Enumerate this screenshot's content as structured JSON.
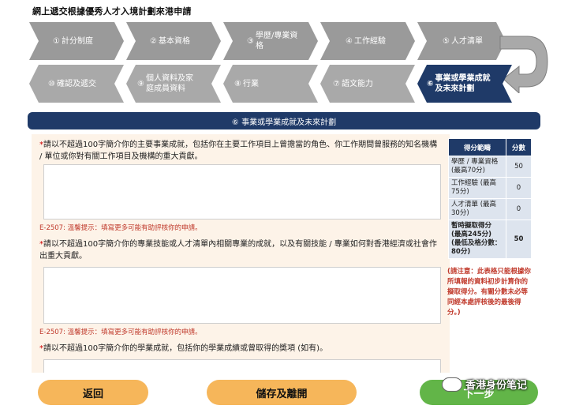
{
  "page_title": "網上遞交根據優秀人才入境計劃來港申請",
  "steps": [
    {
      "num": "①",
      "label": "計分制度",
      "state": "done"
    },
    {
      "num": "②",
      "label": "基本資格",
      "state": "done"
    },
    {
      "num": "③",
      "label": "學歷/專業資格",
      "state": "done"
    },
    {
      "num": "④",
      "label": "工作經驗",
      "state": "done"
    },
    {
      "num": "⑤",
      "label": "人才清單",
      "state": "done"
    },
    {
      "num": "⑩",
      "label": "確認及遞交",
      "state": "pending"
    },
    {
      "num": "⑨",
      "label": "個人資料及家庭成員資料",
      "state": "pending"
    },
    {
      "num": "⑧",
      "label": "行業",
      "state": "pending"
    },
    {
      "num": "⑦",
      "label": "語文能力",
      "state": "pending"
    },
    {
      "num": "⑥",
      "label": "事業或學業成就及未來計劃",
      "state": "active"
    }
  ],
  "section_title": "⑥ 事業或學業成就及未來計劃",
  "questions": [
    {
      "star": "*",
      "text": "請以不超過100字簡介你的主要事業成就，包括你在主要工作項目上曾擔當的角色、你工作期間曾服務的知名機構 / 單位或你對有關工作項目及機構的重大貢獻。",
      "value": "",
      "error": "E-2507: 溫馨提示：填寫更多可能有助評核你的申請。"
    },
    {
      "star": "*",
      "text": "請以不超過100字簡介你的專業技能或人才清單內相關專業的成就，以及有關技能 / 專業如何對香港經濟或社會作出重大貢獻。",
      "value": "",
      "error": "E-2507: 溫馨提示：填寫更多可能有助評核你的申請。"
    },
    {
      "star": "*",
      "text": "請以不超過100字簡介你的學業成就，包括你的學業成績或曾取得的獎項 (如有)。",
      "value": ""
    }
  ],
  "score_table": {
    "headers": [
      "得分範疇",
      "分數"
    ],
    "rows": [
      {
        "label": "學歷 / 專業資格 (最高70分)",
        "value": "50"
      },
      {
        "label": "工作經驗 (最高75分)",
        "value": "0"
      },
      {
        "label": "人才清單 (最高30分)",
        "value": "0"
      },
      {
        "label": "暫時擬取得分 (最高245分) (最低及格分數：80分)",
        "value": "50"
      }
    ]
  },
  "note": "(請注意：此表格只能根據你所填報的資料初步計算你的擬取得分。有關分數未必等同經本處評核後的最後得分。)",
  "buttons": {
    "back": "返回",
    "save_exit": "儲存及離開",
    "next": "下一步"
  },
  "watermark": "香港身份笔记",
  "colors": {
    "done": "#9a9a9a",
    "pending": "#a9a9a9",
    "active": "#1f3a68",
    "orange": "#f6b65a",
    "green": "#62b548"
  }
}
